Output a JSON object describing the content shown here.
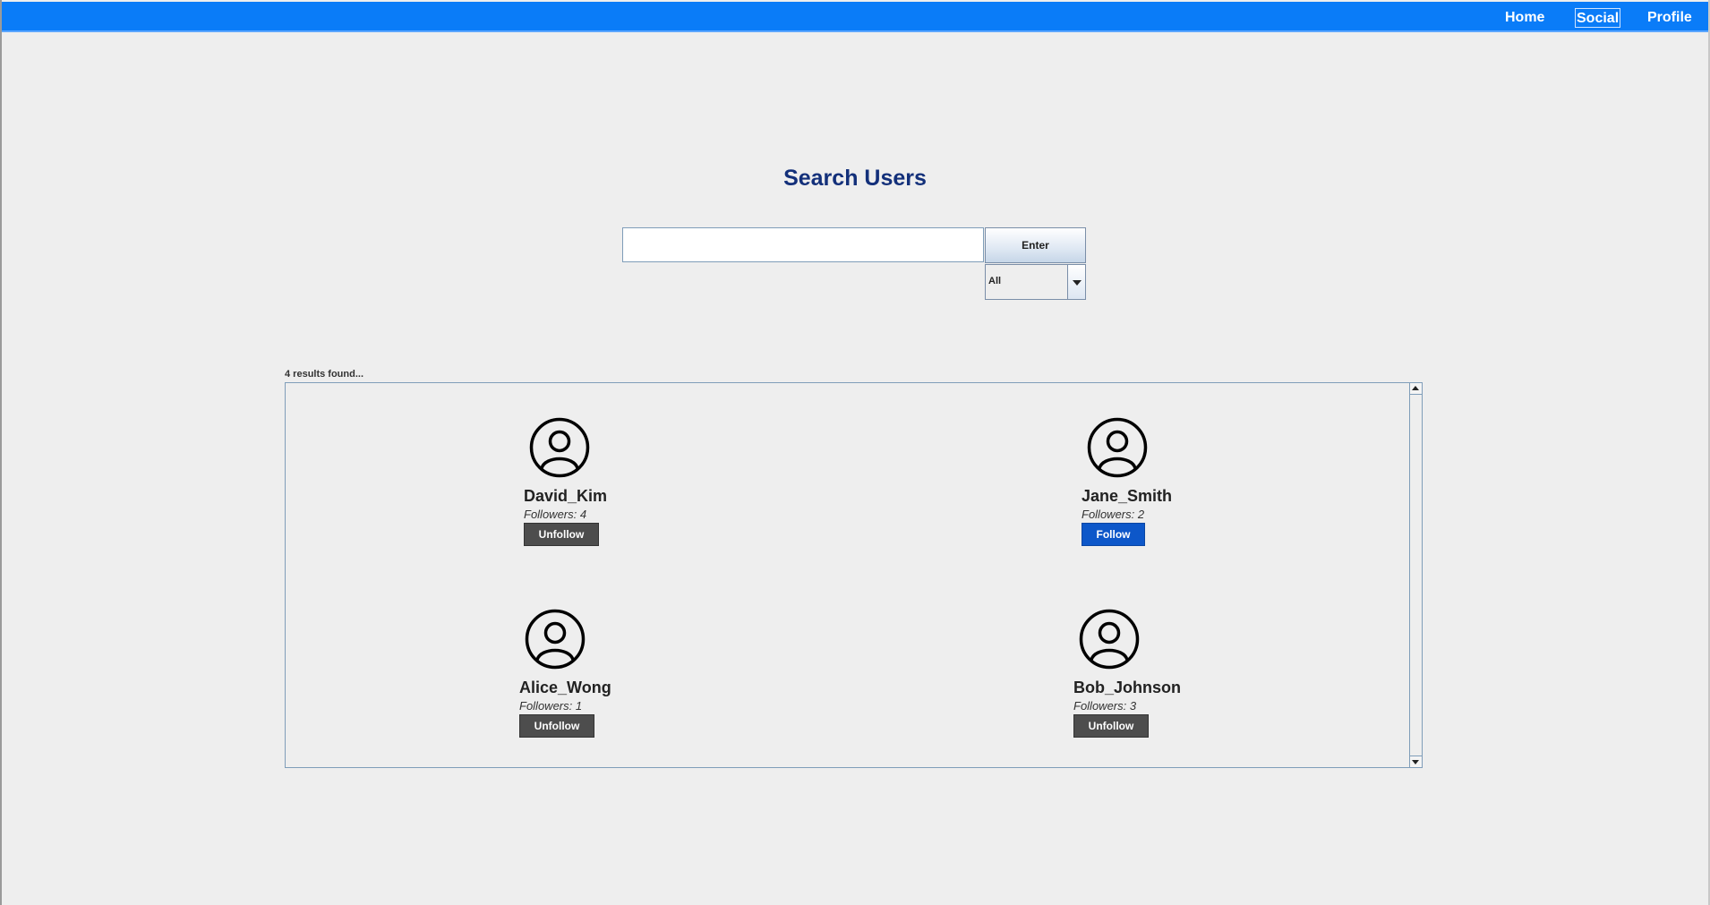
{
  "nav": {
    "items": [
      {
        "label": "Home"
      },
      {
        "label": "Social"
      },
      {
        "label": "Profile"
      }
    ],
    "active": "Social"
  },
  "search": {
    "title": "Search Users",
    "input_value": "",
    "enter_label": "Enter",
    "filter_selected": "All"
  },
  "results": {
    "count_text": "4 results found...",
    "users": [
      {
        "name": "David_Kim",
        "followers": "Followers: 4",
        "action": "Unfollow",
        "avatar_icon": "user-circle-icon"
      },
      {
        "name": "Jane_Smith",
        "followers": "Followers: 2",
        "action": "Follow",
        "avatar_icon": "user-circle-icon"
      },
      {
        "name": "Alice_Wong",
        "followers": "Followers: 1",
        "action": "Unfollow",
        "avatar_icon": "user-circle-icon"
      },
      {
        "name": "Bob_Johnson",
        "followers": "Followers: 3",
        "action": "Unfollow",
        "avatar_icon": "user-circle-icon"
      }
    ]
  },
  "colors": {
    "topbar": "#0a7cf8",
    "title": "#13307a",
    "follow_button": "#0d57c9",
    "unfollow_button": "#4d4d4d",
    "background": "#eeeeee"
  }
}
